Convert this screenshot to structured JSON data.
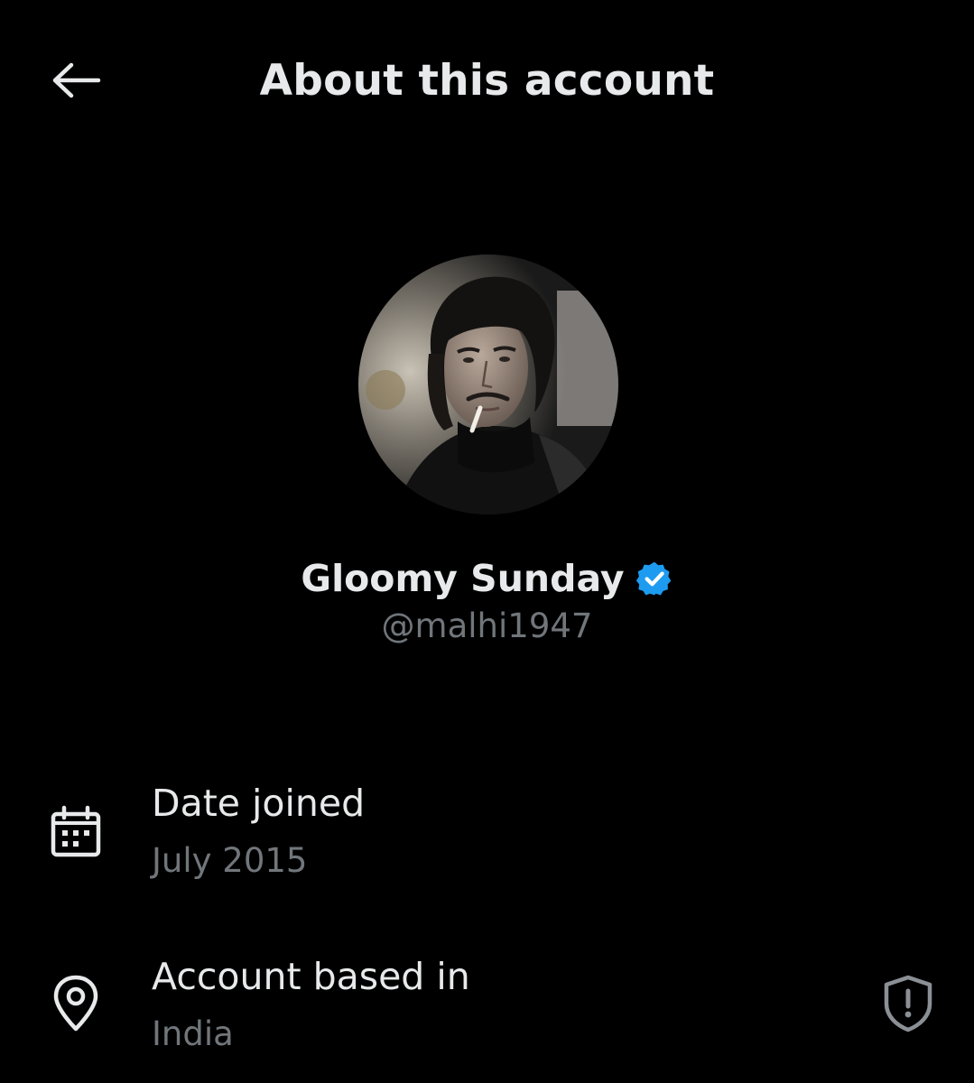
{
  "header": {
    "title": "About this account",
    "back_icon": "arrow-left-icon"
  },
  "profile": {
    "display_name": "Gloomy Sunday",
    "handle": "@malhi1947",
    "verified": true,
    "verified_icon": "verified-badge-icon",
    "verified_color": "#1d9bf0"
  },
  "details": {
    "date_joined": {
      "label": "Date joined",
      "value": "July 2015",
      "icon": "calendar-icon"
    },
    "based_in": {
      "label": "Account based in",
      "value": "India",
      "icon": "location-pin-icon",
      "action_icon": "shield-alert-icon"
    }
  },
  "colors": {
    "background": "#000000",
    "primary_text": "#e7e9ea",
    "secondary_text": "#71767b",
    "accent": "#1d9bf0"
  }
}
